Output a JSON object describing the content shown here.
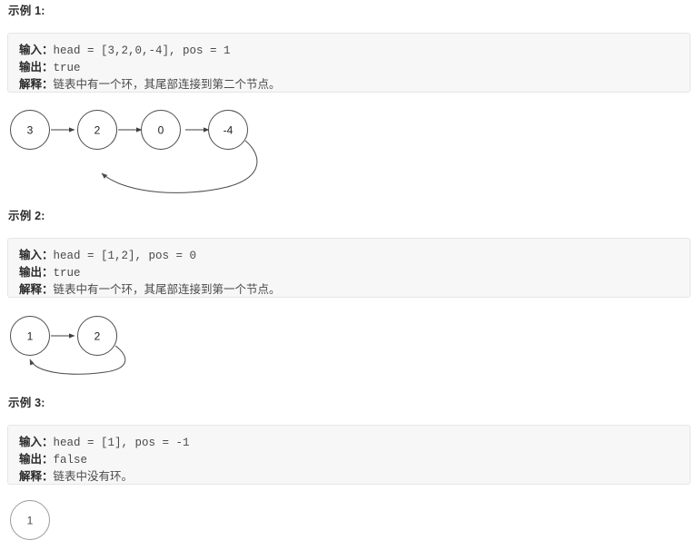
{
  "examples": [
    {
      "title": "示例 1:",
      "input_label": "输入：",
      "input_value": "head = [3,2,0,-4], pos = 1",
      "output_label": "输出：",
      "output_value": "true",
      "explain_label": "解释：",
      "explain_value": "链表中有一个环，其尾部连接到第二个节点。",
      "diagram": {
        "nodes": [
          "3",
          "2",
          "0",
          "-4"
        ],
        "cycle_from_index": 3,
        "cycle_to_index": 1,
        "has_cycle": true
      }
    },
    {
      "title": "示例 2:",
      "input_label": "输入：",
      "input_value": "head = [1,2], pos = 0",
      "output_label": "输出：",
      "output_value": "true",
      "explain_label": "解释：",
      "explain_value": "链表中有一个环，其尾部连接到第一个节点。",
      "diagram": {
        "nodes": [
          "1",
          "2"
        ],
        "cycle_from_index": 1,
        "cycle_to_index": 0,
        "has_cycle": true
      }
    },
    {
      "title": "示例 3:",
      "input_label": "输入：",
      "input_value": "head = [1], pos = -1",
      "output_label": "输出：",
      "output_value": "false",
      "explain_label": "解释：",
      "explain_value": "链表中没有环。",
      "diagram": {
        "nodes": [
          "1"
        ],
        "cycle_from_index": -1,
        "cycle_to_index": -1,
        "has_cycle": false
      }
    }
  ],
  "colors": {
    "code_background": "#f7f7f7",
    "code_border": "#e6e6e6",
    "code_text": "#4a4a4a",
    "label_text": "#2b2b2b",
    "node_stroke": "#4c4c4c",
    "edge_stroke": "#3f3f3f",
    "faded_stroke": "#9a9a9a"
  }
}
